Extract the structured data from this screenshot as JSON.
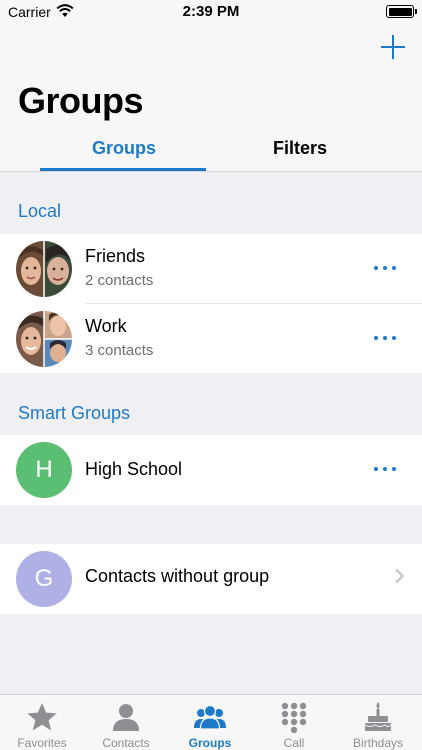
{
  "status_bar": {
    "carrier": "Carrier",
    "time": "2:39 PM"
  },
  "header": {
    "title": "Groups",
    "tabs": [
      {
        "label": "Groups",
        "active": true
      },
      {
        "label": "Filters",
        "active": false
      }
    ]
  },
  "sections": [
    {
      "title": "Local",
      "groups": [
        {
          "name": "Friends",
          "subtitle": "2 contacts"
        },
        {
          "name": "Work",
          "subtitle": "3 contacts"
        }
      ]
    },
    {
      "title": "Smart Groups",
      "groups": [
        {
          "name": "High School",
          "initial": "H",
          "avatar_color": "#5bbf73"
        }
      ]
    }
  ],
  "ungrouped": {
    "name": "Contacts without group",
    "initial": "G",
    "avatar_color": "#aeb0e6"
  },
  "tab_bar": {
    "items": [
      {
        "label": "Favorites",
        "icon": "star-icon"
      },
      {
        "label": "Contacts",
        "icon": "person-icon"
      },
      {
        "label": "Groups",
        "icon": "group-icon",
        "active": true
      },
      {
        "label": "Call",
        "icon": "keypad-icon"
      },
      {
        "label": "Birthdays",
        "icon": "cake-icon"
      }
    ]
  },
  "colors": {
    "accent": "#1e7ac8",
    "background": "#efeff4"
  }
}
